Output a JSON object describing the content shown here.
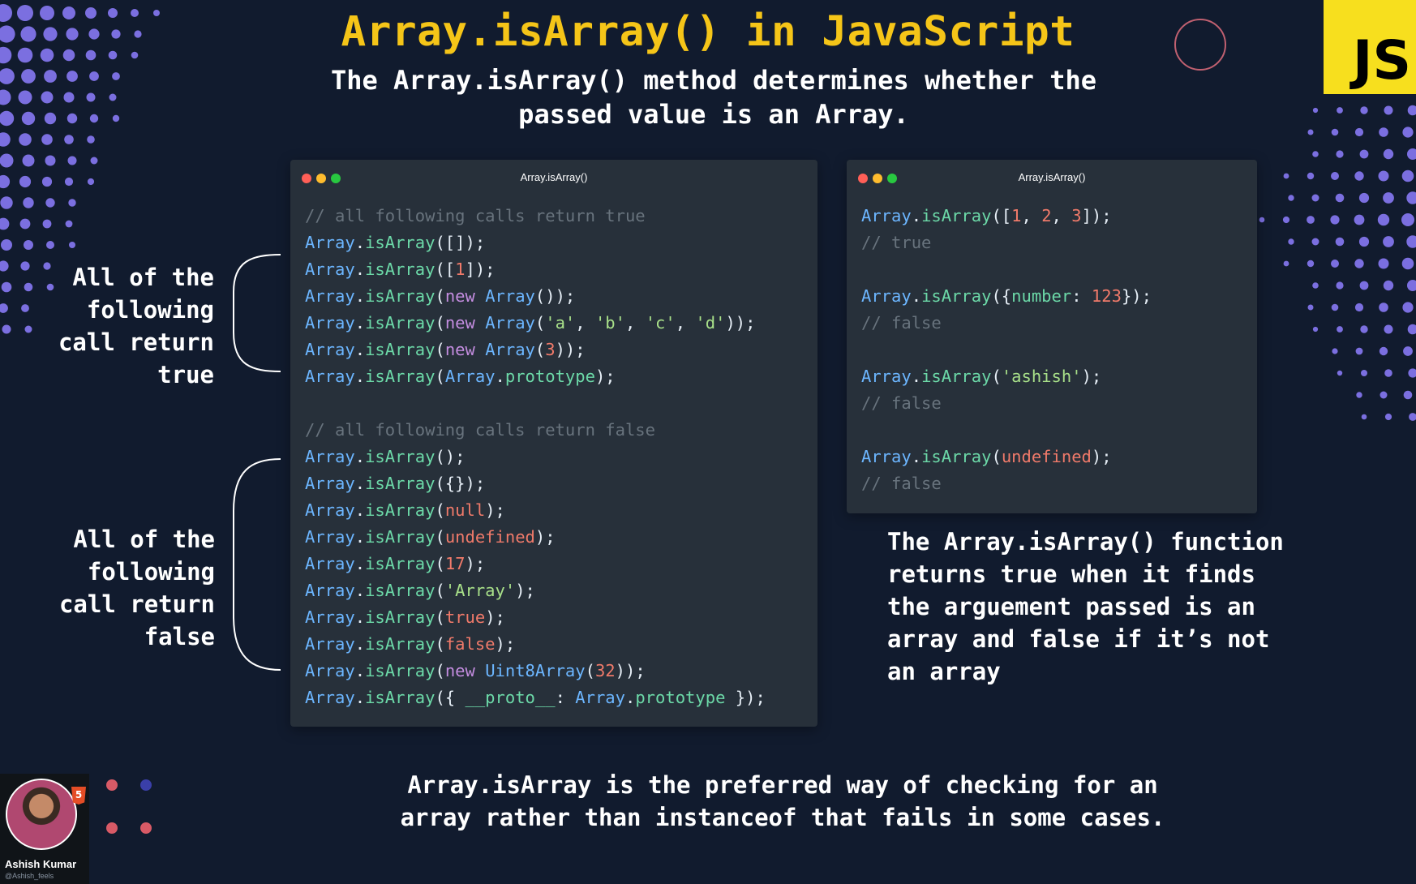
{
  "header": {
    "title": "Array.isArray() in JavaScript",
    "subtitle_line1": "The Array.isArray() method determines whether the",
    "subtitle_line2": "passed value is an Array.",
    "badge": "JS"
  },
  "left_window": {
    "title": "Array.isArray()",
    "lines": [
      [
        {
          "t": "// all following calls return true",
          "c": "cm"
        }
      ],
      [
        {
          "t": "Array",
          "c": "cls"
        },
        {
          "t": ".",
          "c": "p"
        },
        {
          "t": "isArray",
          "c": "fn"
        },
        {
          "t": "([]);",
          "c": "p"
        }
      ],
      [
        {
          "t": "Array",
          "c": "cls"
        },
        {
          "t": ".",
          "c": "p"
        },
        {
          "t": "isArray",
          "c": "fn"
        },
        {
          "t": "([",
          "c": "p"
        },
        {
          "t": "1",
          "c": "num"
        },
        {
          "t": "]);",
          "c": "p"
        }
      ],
      [
        {
          "t": "Array",
          "c": "cls"
        },
        {
          "t": ".",
          "c": "p"
        },
        {
          "t": "isArray",
          "c": "fn"
        },
        {
          "t": "(",
          "c": "p"
        },
        {
          "t": "new",
          "c": "kw"
        },
        {
          "t": " ",
          "c": "p"
        },
        {
          "t": "Array",
          "c": "cls"
        },
        {
          "t": "());",
          "c": "p"
        }
      ],
      [
        {
          "t": "Array",
          "c": "cls"
        },
        {
          "t": ".",
          "c": "p"
        },
        {
          "t": "isArray",
          "c": "fn"
        },
        {
          "t": "(",
          "c": "p"
        },
        {
          "t": "new",
          "c": "kw"
        },
        {
          "t": " ",
          "c": "p"
        },
        {
          "t": "Array",
          "c": "cls"
        },
        {
          "t": "(",
          "c": "p"
        },
        {
          "t": "'a'",
          "c": "str"
        },
        {
          "t": ", ",
          "c": "p"
        },
        {
          "t": "'b'",
          "c": "str"
        },
        {
          "t": ", ",
          "c": "p"
        },
        {
          "t": "'c'",
          "c": "str"
        },
        {
          "t": ", ",
          "c": "p"
        },
        {
          "t": "'d'",
          "c": "str"
        },
        {
          "t": "));",
          "c": "p"
        }
      ],
      [
        {
          "t": "Array",
          "c": "cls"
        },
        {
          "t": ".",
          "c": "p"
        },
        {
          "t": "isArray",
          "c": "fn"
        },
        {
          "t": "(",
          "c": "p"
        },
        {
          "t": "new",
          "c": "kw"
        },
        {
          "t": " ",
          "c": "p"
        },
        {
          "t": "Array",
          "c": "cls"
        },
        {
          "t": "(",
          "c": "p"
        },
        {
          "t": "3",
          "c": "num"
        },
        {
          "t": "));",
          "c": "p"
        }
      ],
      [
        {
          "t": "Array",
          "c": "cls"
        },
        {
          "t": ".",
          "c": "p"
        },
        {
          "t": "isArray",
          "c": "fn"
        },
        {
          "t": "(",
          "c": "p"
        },
        {
          "t": "Array",
          "c": "cls"
        },
        {
          "t": ".",
          "c": "p"
        },
        {
          "t": "prototype",
          "c": "fn"
        },
        {
          "t": ");",
          "c": "p"
        }
      ],
      [],
      [
        {
          "t": "// all following calls return false",
          "c": "cm"
        }
      ],
      [
        {
          "t": "Array",
          "c": "cls"
        },
        {
          "t": ".",
          "c": "p"
        },
        {
          "t": "isArray",
          "c": "fn"
        },
        {
          "t": "();",
          "c": "p"
        }
      ],
      [
        {
          "t": "Array",
          "c": "cls"
        },
        {
          "t": ".",
          "c": "p"
        },
        {
          "t": "isArray",
          "c": "fn"
        },
        {
          "t": "({});",
          "c": "p"
        }
      ],
      [
        {
          "t": "Array",
          "c": "cls"
        },
        {
          "t": ".",
          "c": "p"
        },
        {
          "t": "isArray",
          "c": "fn"
        },
        {
          "t": "(",
          "c": "p"
        },
        {
          "t": "null",
          "c": "lit"
        },
        {
          "t": ");",
          "c": "p"
        }
      ],
      [
        {
          "t": "Array",
          "c": "cls"
        },
        {
          "t": ".",
          "c": "p"
        },
        {
          "t": "isArray",
          "c": "fn"
        },
        {
          "t": "(",
          "c": "p"
        },
        {
          "t": "undefined",
          "c": "lit"
        },
        {
          "t": ");",
          "c": "p"
        }
      ],
      [
        {
          "t": "Array",
          "c": "cls"
        },
        {
          "t": ".",
          "c": "p"
        },
        {
          "t": "isArray",
          "c": "fn"
        },
        {
          "t": "(",
          "c": "p"
        },
        {
          "t": "17",
          "c": "num"
        },
        {
          "t": ");",
          "c": "p"
        }
      ],
      [
        {
          "t": "Array",
          "c": "cls"
        },
        {
          "t": ".",
          "c": "p"
        },
        {
          "t": "isArray",
          "c": "fn"
        },
        {
          "t": "(",
          "c": "p"
        },
        {
          "t": "'Array'",
          "c": "str"
        },
        {
          "t": ");",
          "c": "p"
        }
      ],
      [
        {
          "t": "Array",
          "c": "cls"
        },
        {
          "t": ".",
          "c": "p"
        },
        {
          "t": "isArray",
          "c": "fn"
        },
        {
          "t": "(",
          "c": "p"
        },
        {
          "t": "true",
          "c": "lit"
        },
        {
          "t": ");",
          "c": "p"
        }
      ],
      [
        {
          "t": "Array",
          "c": "cls"
        },
        {
          "t": ".",
          "c": "p"
        },
        {
          "t": "isArray",
          "c": "fn"
        },
        {
          "t": "(",
          "c": "p"
        },
        {
          "t": "false",
          "c": "lit"
        },
        {
          "t": ");",
          "c": "p"
        }
      ],
      [
        {
          "t": "Array",
          "c": "cls"
        },
        {
          "t": ".",
          "c": "p"
        },
        {
          "t": "isArray",
          "c": "fn"
        },
        {
          "t": "(",
          "c": "p"
        },
        {
          "t": "new",
          "c": "kw"
        },
        {
          "t": " ",
          "c": "p"
        },
        {
          "t": "Uint8Array",
          "c": "cls"
        },
        {
          "t": "(",
          "c": "p"
        },
        {
          "t": "32",
          "c": "num"
        },
        {
          "t": "));",
          "c": "p"
        }
      ],
      [
        {
          "t": "Array",
          "c": "cls"
        },
        {
          "t": ".",
          "c": "p"
        },
        {
          "t": "isArray",
          "c": "fn"
        },
        {
          "t": "({ ",
          "c": "p"
        },
        {
          "t": "__proto__",
          "c": "fn"
        },
        {
          "t": ": ",
          "c": "p"
        },
        {
          "t": "Array",
          "c": "cls"
        },
        {
          "t": ".",
          "c": "p"
        },
        {
          "t": "prototype",
          "c": "fn"
        },
        {
          "t": " });",
          "c": "p"
        }
      ]
    ]
  },
  "right_window": {
    "title": "Array.isArray()",
    "lines": [
      [
        {
          "t": "Array",
          "c": "cls"
        },
        {
          "t": ".",
          "c": "p"
        },
        {
          "t": "isArray",
          "c": "fn"
        },
        {
          "t": "([",
          "c": "p"
        },
        {
          "t": "1",
          "c": "num"
        },
        {
          "t": ", ",
          "c": "p"
        },
        {
          "t": "2",
          "c": "num"
        },
        {
          "t": ", ",
          "c": "p"
        },
        {
          "t": "3",
          "c": "num"
        },
        {
          "t": "]);",
          "c": "p"
        }
      ],
      [
        {
          "t": "// true",
          "c": "cm"
        }
      ],
      [],
      [
        {
          "t": "Array",
          "c": "cls"
        },
        {
          "t": ".",
          "c": "p"
        },
        {
          "t": "isArray",
          "c": "fn"
        },
        {
          "t": "({",
          "c": "p"
        },
        {
          "t": "number",
          "c": "fn"
        },
        {
          "t": ": ",
          "c": "p"
        },
        {
          "t": "123",
          "c": "num"
        },
        {
          "t": "});",
          "c": "p"
        }
      ],
      [
        {
          "t": "// false",
          "c": "cm"
        }
      ],
      [],
      [
        {
          "t": "Array",
          "c": "cls"
        },
        {
          "t": ".",
          "c": "p"
        },
        {
          "t": "isArray",
          "c": "fn"
        },
        {
          "t": "(",
          "c": "p"
        },
        {
          "t": "'ashish'",
          "c": "str"
        },
        {
          "t": ");",
          "c": "p"
        }
      ],
      [
        {
          "t": "// false",
          "c": "cm"
        }
      ],
      [],
      [
        {
          "t": "Array",
          "c": "cls"
        },
        {
          "t": ".",
          "c": "p"
        },
        {
          "t": "isArray",
          "c": "fn"
        },
        {
          "t": "(",
          "c": "p"
        },
        {
          "t": "undefined",
          "c": "lit"
        },
        {
          "t": ");",
          "c": "p"
        }
      ],
      [
        {
          "t": "// false",
          "c": "cm"
        }
      ]
    ]
  },
  "labels": {
    "true_group": [
      "All of the",
      "following",
      "call return",
      "true"
    ],
    "false_group": [
      "All of the",
      "following",
      "call return",
      "false"
    ]
  },
  "note": [
    "The Array.isArray() function",
    "returns true when it finds",
    "the arguement passed is an",
    "array and false if it’s not",
    "an array"
  ],
  "footer": {
    "line1": "Array.isArray is the preferred way of checking for an",
    "line2": "array rather than instanceof that fails in some cases."
  },
  "author": {
    "name": "Ashish Kumar",
    "handle": "@Ashish_feels",
    "badge_icon": "html5-icon"
  },
  "colors": {
    "background": "#111b2e",
    "title": "#f5c518",
    "js_badge": "#f7df1e",
    "dots": "#7b6fe0",
    "window_bg": "#27303a"
  }
}
